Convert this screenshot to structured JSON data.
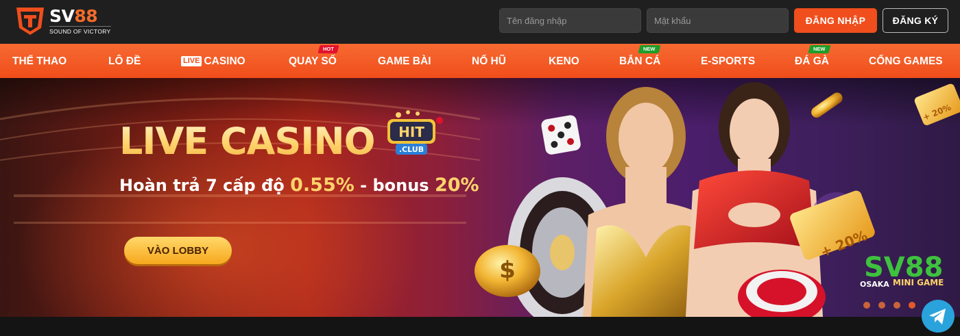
{
  "header": {
    "logo": {
      "name_main": "SV",
      "name_accent": "88",
      "tagline": "SOUND OF VICTORY",
      "icon": "sv88-shield-logo"
    },
    "username_placeholder": "Tên đăng nhập",
    "password_placeholder": "Mật khẩu",
    "login_label": "ĐĂNG NHẬP",
    "register_label": "ĐĂNG KÝ"
  },
  "nav": {
    "items": [
      {
        "label": "THỂ THAO"
      },
      {
        "label": "LÔ ĐỀ"
      },
      {
        "badge": "LIVE",
        "label": "CASINO"
      },
      {
        "label": "QUAY SỐ",
        "tag": "HOT"
      },
      {
        "label": "GAME BÀI"
      },
      {
        "label": "NỔ HŨ"
      },
      {
        "label": "KENO"
      },
      {
        "label": "BẮN CÁ",
        "tag": "NEW"
      },
      {
        "label": "E-SPORTS"
      },
      {
        "label": "ĐÁ GÀ",
        "tag": "NEW"
      },
      {
        "label": "CỔNG GAMES"
      }
    ]
  },
  "banner": {
    "title": "LIVE CASINO",
    "subtitle_prefix": "Hoàn trả 7 cấp độ",
    "subtitle_rate": "0.55%",
    "subtitle_mid": "- bonus",
    "subtitle_bonus": "20%",
    "cta_label": "VÀO LOBBY",
    "partner_logo": {
      "top": "HIT",
      "bottom": ".CLUB"
    },
    "ticket_text": "+ 20%",
    "watermark": "SV88",
    "watermark_sub": "OSAKA",
    "chip_text": "MINI GAME"
  },
  "colors": {
    "accent": "#f04e1c",
    "nav_bg": "#f25a26",
    "header_bg": "#1f1f1f",
    "gold": "#ffd36b",
    "tag_hot": "#e3122d",
    "tag_new": "#1e9e2a"
  },
  "icons": {
    "floating": "telegram-icon"
  }
}
